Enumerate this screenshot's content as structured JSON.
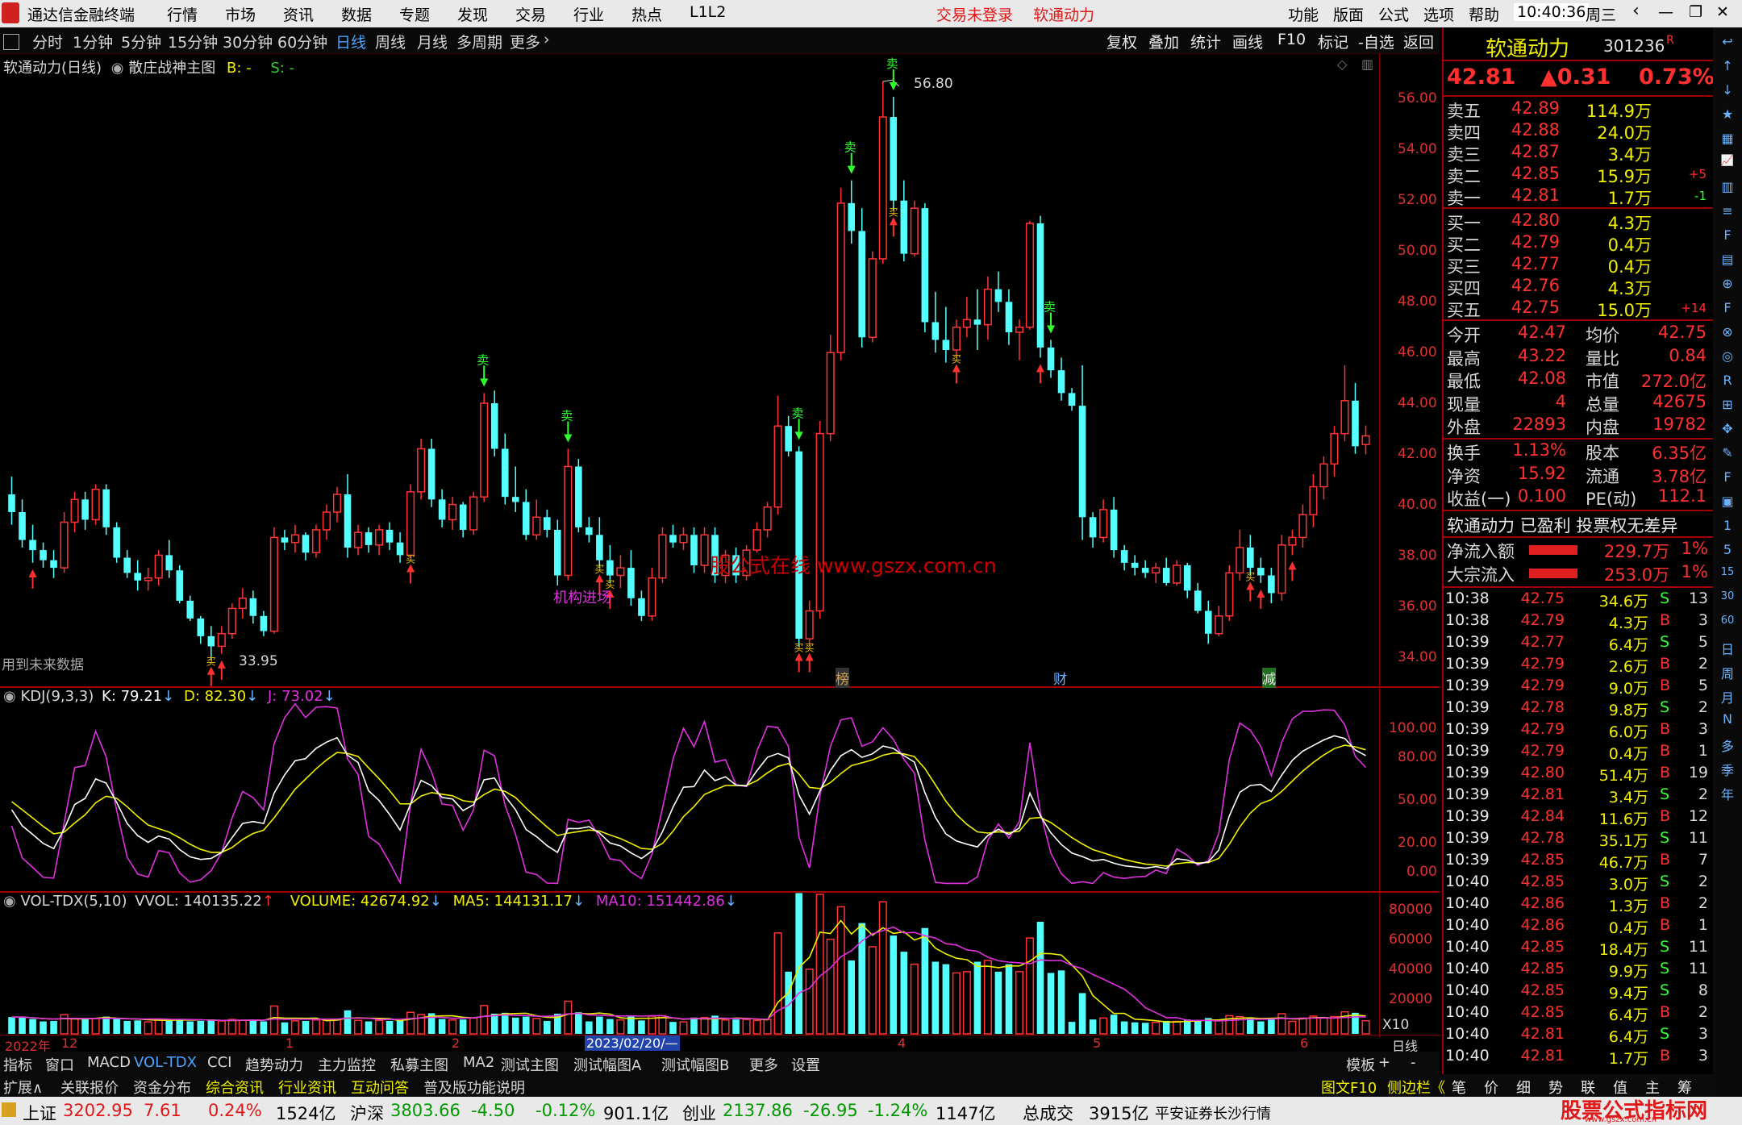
{
  "titlebar": {
    "app_name": "通达信金融终端",
    "menus": [
      "行情",
      "市场",
      "资讯",
      "数据",
      "专题",
      "发现",
      "交易",
      "行业",
      "热点",
      "L1L2"
    ],
    "trade_status": "交易未登录",
    "stock_name": "软通动力",
    "right_menus": [
      "功能",
      "版面",
      "公式",
      "选项",
      "帮助"
    ],
    "time": "10:40:36",
    "weekday": "周三"
  },
  "period_toolbar": {
    "items": [
      "分时",
      "1分钟",
      "5分钟",
      "15分钟",
      "30分钟",
      "60分钟",
      "日线",
      "周线",
      "月线",
      "多周期",
      "更多"
    ],
    "selected": "日线"
  },
  "right_toolbar": [
    "复权",
    "叠加",
    "统计",
    "画线",
    "F10",
    "标记",
    "-自选",
    "返回"
  ],
  "main_chart": {
    "header_name": "软通动力(日线)",
    "indicator": "散庄战神主图",
    "b_label": "B: -",
    "s_label": "S: -",
    "high_mark": "56.80",
    "low_mark": "33.95",
    "future_note": "用到未来数据",
    "inst_label": "机构进场",
    "watermark": "股公式在线  www.gszx.com.cn",
    "event_markers": [
      "榜",
      "财",
      "减"
    ],
    "buy_char": "买",
    "sell_char": "卖"
  },
  "kdj": {
    "name": "KDJ(9,3,3)",
    "k": "K: 79.21",
    "d": "D: 82.30",
    "j": "J: 73.02",
    "scale": [
      "100.00",
      "80.00",
      "50.00",
      "20.00",
      "0.00"
    ]
  },
  "vol": {
    "name": "VOL-TDX(5,10)",
    "vvol": "VVOL: 140135.22",
    "volume": "VOLUME: 42674.92",
    "ma5": "MA5: 144131.17",
    "ma10": "MA10: 151442.86",
    "scale": [
      "80000",
      "60000",
      "40000",
      "20000",
      "X10"
    ]
  },
  "time_axis": {
    "labels": [
      "2022年",
      "12",
      "1",
      "2",
      "2023/02/20/—",
      "4",
      "5",
      "6"
    ],
    "period": "日线"
  },
  "chart_data": {
    "type": "candlestick",
    "price_axis": [
      "56.00",
      "54.00",
      "52.00",
      "50.00",
      "48.00",
      "46.00",
      "44.00",
      "42.00",
      "40.00",
      "38.00",
      "36.00",
      "34.00"
    ],
    "ylim": [
      33.4,
      57.6
    ],
    "ohlc": [
      [
        40.5,
        41.2,
        39.3,
        39.8
      ],
      [
        39.8,
        40.3,
        38.4,
        38.7
      ],
      [
        38.7,
        39.3,
        37.8,
        38.3
      ],
      [
        38.3,
        38.6,
        37.6,
        37.9
      ],
      [
        37.9,
        38.3,
        37.2,
        37.6
      ],
      [
        37.6,
        39.8,
        37.4,
        39.4
      ],
      [
        39.4,
        40.6,
        39.0,
        40.3
      ],
      [
        40.3,
        40.6,
        39.1,
        39.5
      ],
      [
        39.5,
        40.9,
        39.3,
        40.7
      ],
      [
        40.7,
        40.9,
        38.9,
        39.2
      ],
      [
        39.2,
        39.4,
        37.8,
        38.0
      ],
      [
        38.0,
        38.3,
        37.2,
        37.4
      ],
      [
        37.4,
        37.9,
        36.7,
        37.1
      ],
      [
        37.1,
        37.6,
        36.7,
        37.2
      ],
      [
        37.2,
        38.3,
        36.9,
        38.1
      ],
      [
        38.1,
        38.7,
        37.2,
        37.5
      ],
      [
        37.5,
        37.7,
        36.2,
        36.3
      ],
      [
        36.3,
        36.5,
        35.5,
        35.6
      ],
      [
        35.6,
        35.7,
        34.6,
        34.9
      ],
      [
        34.9,
        35.3,
        33.95,
        34.5
      ],
      [
        34.5,
        35.3,
        34.2,
        35.0
      ],
      [
        35.0,
        36.2,
        34.8,
        36.0
      ],
      [
        36.0,
        36.8,
        35.6,
        36.4
      ],
      [
        36.4,
        36.7,
        35.4,
        35.7
      ],
      [
        35.7,
        35.9,
        34.9,
        35.1
      ],
      [
        35.1,
        39.2,
        35.0,
        38.8
      ],
      [
        38.8,
        39.1,
        38.3,
        38.6
      ],
      [
        38.6,
        39.3,
        38.2,
        38.9
      ],
      [
        38.9,
        39.0,
        37.9,
        38.2
      ],
      [
        38.2,
        39.3,
        38.0,
        39.1
      ],
      [
        39.1,
        40.1,
        38.7,
        39.8
      ],
      [
        39.8,
        40.8,
        39.4,
        40.5
      ],
      [
        40.5,
        41.3,
        38.0,
        38.4
      ],
      [
        38.4,
        39.3,
        38.1,
        39.0
      ],
      [
        39.0,
        39.2,
        38.2,
        38.5
      ],
      [
        38.5,
        39.3,
        38.1,
        39.1
      ],
      [
        39.1,
        39.4,
        38.3,
        38.6
      ],
      [
        38.6,
        39.0,
        37.8,
        38.1
      ],
      [
        38.1,
        40.9,
        38.0,
        40.6
      ],
      [
        40.6,
        42.7,
        40.3,
        42.3
      ],
      [
        42.3,
        42.7,
        40.0,
        40.3
      ],
      [
        40.3,
        40.7,
        39.2,
        39.5
      ],
      [
        39.5,
        40.4,
        39.1,
        40.1
      ],
      [
        40.1,
        40.2,
        38.8,
        39.1
      ],
      [
        39.1,
        40.6,
        38.9,
        40.4
      ],
      [
        40.4,
        44.5,
        40.2,
        44.1
      ],
      [
        44.1,
        44.6,
        42.0,
        42.3
      ],
      [
        42.3,
        42.9,
        40.1,
        40.4
      ],
      [
        40.4,
        41.6,
        39.8,
        40.2
      ],
      [
        40.2,
        40.7,
        38.7,
        38.9
      ],
      [
        38.9,
        40.3,
        38.7,
        39.6
      ],
      [
        39.6,
        39.9,
        38.8,
        39.1
      ],
      [
        39.1,
        39.5,
        36.9,
        37.3
      ],
      [
        37.3,
        42.3,
        37.1,
        41.6
      ],
      [
        41.6,
        41.9,
        39.0,
        39.2
      ],
      [
        39.2,
        39.6,
        38.6,
        38.9
      ],
      [
        38.9,
        39.6,
        37.6,
        37.9
      ],
      [
        37.9,
        38.5,
        37.0,
        37.3
      ],
      [
        37.3,
        38.1,
        36.8,
        37.6
      ],
      [
        37.6,
        38.3,
        36.1,
        36.4
      ],
      [
        36.4,
        36.7,
        35.5,
        35.7
      ],
      [
        35.7,
        37.6,
        35.5,
        37.2
      ],
      [
        37.2,
        39.2,
        37.0,
        38.9
      ],
      [
        38.9,
        39.3,
        38.4,
        38.6
      ],
      [
        38.6,
        39.2,
        38.3,
        38.9
      ],
      [
        38.9,
        39.2,
        37.4,
        37.7
      ],
      [
        37.7,
        39.2,
        37.4,
        38.9
      ],
      [
        38.9,
        39.2,
        37.0,
        37.3
      ],
      [
        37.3,
        38.3,
        37.0,
        38.1
      ],
      [
        38.1,
        38.4,
        37.0,
        37.3
      ],
      [
        37.3,
        38.5,
        37.1,
        38.3
      ],
      [
        38.3,
        39.4,
        38.2,
        39.1
      ],
      [
        39.1,
        40.2,
        38.8,
        40.0
      ],
      [
        40.0,
        44.4,
        39.7,
        43.2
      ],
      [
        43.2,
        43.6,
        42.0,
        42.2
      ],
      [
        42.2,
        42.4,
        34.5,
        34.8
      ],
      [
        34.8,
        36.3,
        34.5,
        35.9
      ],
      [
        35.9,
        43.4,
        35.6,
        42.9
      ],
      [
        42.9,
        46.8,
        42.6,
        46.1
      ],
      [
        46.1,
        52.6,
        45.8,
        52.0
      ],
      [
        52.0,
        52.9,
        50.4,
        50.9
      ],
      [
        50.9,
        51.8,
        46.3,
        46.7
      ],
      [
        46.7,
        50.1,
        46.5,
        49.8
      ],
      [
        49.8,
        56.8,
        49.6,
        55.4
      ],
      [
        55.4,
        56.2,
        51.7,
        52.1
      ],
      [
        52.1,
        52.9,
        49.7,
        50.0
      ],
      [
        50.0,
        52.1,
        49.9,
        51.8
      ],
      [
        51.8,
        52.0,
        46.9,
        47.3
      ],
      [
        47.3,
        48.5,
        46.1,
        46.6
      ],
      [
        46.6,
        47.9,
        45.7,
        46.2
      ],
      [
        46.2,
        47.4,
        45.9,
        47.1
      ],
      [
        47.1,
        48.3,
        46.7,
        47.4
      ],
      [
        47.4,
        48.6,
        46.2,
        47.2
      ],
      [
        47.2,
        49.1,
        46.6,
        48.6
      ],
      [
        48.6,
        49.3,
        47.7,
        48.1
      ],
      [
        48.1,
        48.6,
        46.4,
        46.9
      ],
      [
        46.9,
        47.4,
        45.8,
        47.1
      ],
      [
        47.1,
        51.3,
        47.0,
        51.2
      ],
      [
        51.2,
        51.5,
        45.9,
        46.3
      ],
      [
        46.3,
        46.6,
        45.1,
        45.4
      ],
      [
        45.4,
        45.9,
        44.2,
        44.5
      ],
      [
        44.5,
        44.7,
        43.8,
        44.0
      ],
      [
        44.0,
        45.6,
        38.7,
        39.6
      ],
      [
        39.6,
        39.8,
        38.4,
        38.8
      ],
      [
        38.8,
        40.3,
        38.6,
        39.9
      ],
      [
        39.9,
        40.4,
        38.0,
        38.3
      ],
      [
        38.3,
        38.5,
        37.5,
        37.8
      ],
      [
        37.8,
        38.1,
        37.3,
        37.6
      ],
      [
        37.6,
        37.9,
        37.2,
        37.4
      ],
      [
        37.4,
        37.8,
        37.0,
        37.6
      ],
      [
        37.6,
        38.0,
        36.9,
        37.0
      ],
      [
        37.0,
        37.9,
        36.9,
        37.7
      ],
      [
        37.7,
        37.8,
        36.4,
        36.7
      ],
      [
        36.7,
        37.0,
        35.8,
        35.9
      ],
      [
        35.9,
        36.3,
        34.6,
        35.0
      ],
      [
        35.0,
        36.1,
        34.9,
        35.7
      ],
      [
        35.7,
        37.7,
        35.5,
        37.4
      ],
      [
        37.4,
        39.1,
        37.1,
        38.4
      ],
      [
        38.4,
        38.9,
        37.3,
        37.6
      ],
      [
        37.6,
        38.0,
        37.0,
        37.3
      ],
      [
        37.3,
        37.6,
        36.2,
        36.6
      ],
      [
        36.6,
        38.9,
        36.3,
        38.5
      ],
      [
        38.5,
        39.1,
        38.1,
        38.8
      ],
      [
        38.8,
        40.1,
        38.4,
        39.7
      ],
      [
        39.7,
        41.3,
        39.2,
        40.8
      ],
      [
        40.8,
        42.0,
        40.3,
        41.7
      ],
      [
        41.7,
        43.2,
        41.2,
        42.9
      ],
      [
        42.9,
        45.6,
        42.6,
        44.2
      ],
      [
        44.2,
        44.9,
        42.1,
        42.4
      ],
      [
        42.47,
        43.22,
        42.08,
        42.81
      ]
    ]
  },
  "quote": {
    "name": "软通动力",
    "code": "301236",
    "badge": "R",
    "price": "42.81",
    "change": "▲0.31",
    "pct": "0.73%",
    "asks": [
      {
        "label": "卖五",
        "p": "42.89",
        "v": "114.9万",
        "d": ""
      },
      {
        "label": "卖四",
        "p": "42.88",
        "v": "24.0万",
        "d": ""
      },
      {
        "label": "卖三",
        "p": "42.87",
        "v": "3.4万",
        "d": ""
      },
      {
        "label": "卖二",
        "p": "42.85",
        "v": "15.9万",
        "d": "+5"
      },
      {
        "label": "卖一",
        "p": "42.81",
        "v": "1.7万",
        "d": "-1"
      }
    ],
    "bids": [
      {
        "label": "买一",
        "p": "42.80",
        "v": "4.3万",
        "d": ""
      },
      {
        "label": "买二",
        "p": "42.79",
        "v": "0.4万",
        "d": ""
      },
      {
        "label": "买三",
        "p": "42.77",
        "v": "0.4万",
        "d": ""
      },
      {
        "label": "买四",
        "p": "42.76",
        "v": "4.3万",
        "d": ""
      },
      {
        "label": "买五",
        "p": "42.75",
        "v": "15.0万",
        "d": "+14"
      }
    ],
    "stats": [
      {
        "l1": "今开",
        "v1": "42.47",
        "l2": "均价",
        "v2": "42.75"
      },
      {
        "l1": "最高",
        "v1": "43.22",
        "l2": "量比",
        "v2": "0.84"
      },
      {
        "l1": "最低",
        "v1": "42.08",
        "l2": "市值",
        "v2": "272.0亿"
      },
      {
        "l1": "现量",
        "v1": "4",
        "l2": "总量",
        "v2": "42675"
      },
      {
        "l1": "外盘",
        "v1": "22893",
        "l2": "内盘",
        "v2": "19782"
      }
    ],
    "stats2": [
      {
        "l1": "换手",
        "v1": "1.13%",
        "l2": "股本",
        "v2": "6.35亿"
      },
      {
        "l1": "净资",
        "v1": "15.92",
        "l2": "流通",
        "v2": "3.78亿"
      },
      {
        "l1": "收益(一)",
        "v1": "0.100",
        "l2": "PE(动)",
        "v2": "112.1"
      }
    ],
    "profile": "软通动力 已盈利 投票权无差异",
    "flows": [
      {
        "label": "净流入额",
        "value": "229.7万",
        "pct": "1%"
      },
      {
        "label": "大宗流入",
        "value": "253.0万",
        "pct": "1%"
      }
    ],
    "ticks": [
      [
        "10:38",
        "42.75",
        "34.6万",
        "S",
        "13"
      ],
      [
        "10:38",
        "42.79",
        "4.3万",
        "B",
        "3"
      ],
      [
        "10:39",
        "42.77",
        "6.4万",
        "S",
        "5"
      ],
      [
        "10:39",
        "42.79",
        "2.6万",
        "B",
        "2"
      ],
      [
        "10:39",
        "42.79",
        "9.0万",
        "B",
        "5"
      ],
      [
        "10:39",
        "42.78",
        "9.8万",
        "S",
        "2"
      ],
      [
        "10:39",
        "42.79",
        "6.0万",
        "B",
        "3"
      ],
      [
        "10:39",
        "42.79",
        "0.4万",
        "B",
        "1"
      ],
      [
        "10:39",
        "42.80",
        "51.4万",
        "B",
        "19"
      ],
      [
        "10:39",
        "42.81",
        "3.4万",
        "S",
        "2"
      ],
      [
        "10:39",
        "42.84",
        "11.6万",
        "B",
        "12"
      ],
      [
        "10:39",
        "42.78",
        "35.1万",
        "S",
        "11"
      ],
      [
        "10:39",
        "42.85",
        "46.7万",
        "B",
        "7"
      ],
      [
        "10:40",
        "42.85",
        "3.0万",
        "S",
        "2"
      ],
      [
        "10:40",
        "42.86",
        "1.3万",
        "B",
        "2"
      ],
      [
        "10:40",
        "42.86",
        "0.4万",
        "B",
        "1"
      ],
      [
        "10:40",
        "42.85",
        "18.4万",
        "S",
        "11"
      ],
      [
        "10:40",
        "42.85",
        "9.9万",
        "S",
        "11"
      ],
      [
        "10:40",
        "42.85",
        "9.4万",
        "S",
        "8"
      ],
      [
        "10:40",
        "42.85",
        "6.4万",
        "B",
        "2"
      ],
      [
        "10:40",
        "42.81",
        "6.4万",
        "S",
        "3"
      ],
      [
        "10:40",
        "42.81",
        "1.7万",
        "B",
        "3"
      ]
    ]
  },
  "side_icons": [
    "↩",
    "↑",
    "↓",
    "★",
    "▦",
    "📈",
    "▥",
    "≡",
    "F",
    "▤",
    "⊕",
    "F",
    "⊗",
    "◎",
    "R",
    "⊞",
    "✥",
    "✎",
    "F",
    "▣",
    "1",
    "5",
    "15",
    "30",
    "60",
    "日",
    "周",
    "月",
    "N",
    "多",
    "季",
    "年"
  ],
  "bottom_tabs": [
    "指标",
    "窗口",
    "MACD",
    "VOL-TDX",
    "CCI",
    "趋势动力",
    "主力监控",
    "私募主图",
    "MA2",
    "测试主图",
    "测试幅图A",
    "测试幅图B",
    "更多",
    "设置"
  ],
  "bottom_tabs_right": [
    "模板",
    "+",
    "-"
  ],
  "bottom_tabs2": [
    "扩展∧",
    "关联报价",
    "资金分布",
    "综合资讯",
    "行业资讯",
    "互动问答",
    "普及版功能说明"
  ],
  "bottom_tabs2_right": [
    "图文F10",
    "侧边栏《",
    "笔",
    "价",
    "细",
    "势",
    "联",
    "值",
    "主",
    "筹"
  ],
  "statusbar": {
    "items": [
      {
        "name": "上证",
        "v": "3202.95",
        "c": "7.61",
        "p": "0.24%",
        "a": "1524亿"
      },
      {
        "name": "沪深",
        "v": "3803.66",
        "c": "-4.50",
        "p": "-0.12%",
        "a": "901.1亿"
      },
      {
        "name": "创业",
        "v": "2137.86",
        "c": "-26.95",
        "p": "-1.24%",
        "a": "1147亿"
      }
    ],
    "total_label": "总成交",
    "total": "3915亿",
    "broker": "平安证券长沙行情",
    "logo": "股票公式指标网",
    "logo_url": "www.gszx.com.cn"
  },
  "colors": {
    "up": "#ff3333",
    "down": "#54ffff",
    "yellow": "#f0f000",
    "white": "#ffffff",
    "magenta": "#e030e0",
    "border": "#a00000"
  }
}
